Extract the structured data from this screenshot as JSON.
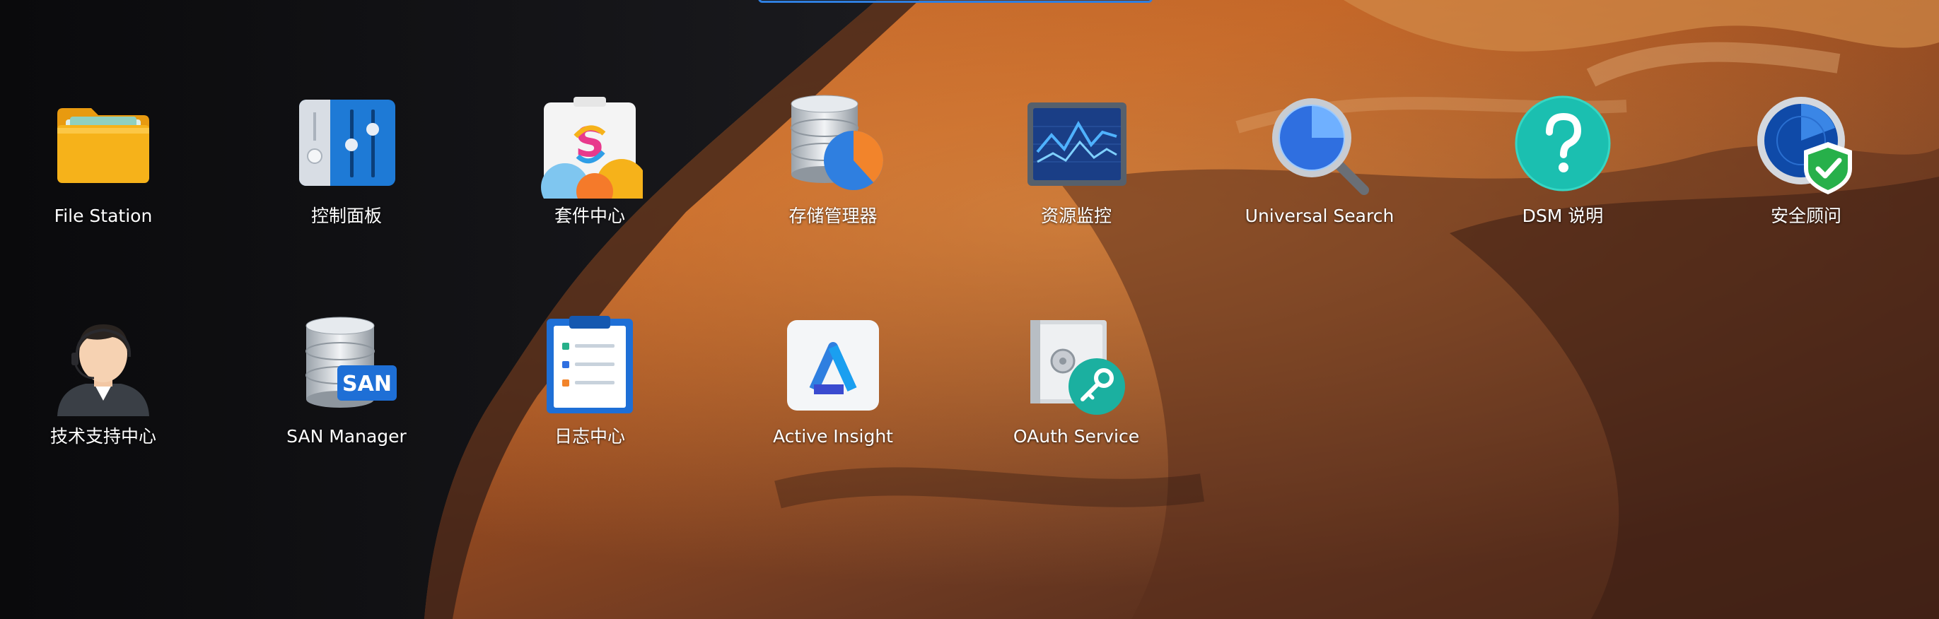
{
  "desktop": {
    "apps": [
      {
        "label": "File Station",
        "icon": "folder-icon"
      },
      {
        "label": "控制面板",
        "icon": "sliders-icon"
      },
      {
        "label": "套件中心",
        "icon": "package-center-icon"
      },
      {
        "label": "存储管理器",
        "icon": "storage-pie-icon"
      },
      {
        "label": "资源监控",
        "icon": "monitor-graph-icon"
      },
      {
        "label": "Universal Search",
        "icon": "magnifier-icon"
      },
      {
        "label": "DSM 说明",
        "icon": "question-icon"
      },
      {
        "label": "安全顾问",
        "icon": "shield-check-icon"
      },
      {
        "label": "技术支持中心",
        "icon": "support-agent-icon"
      },
      {
        "label": "SAN Manager",
        "icon": "san-database-icon"
      },
      {
        "label": "日志中心",
        "icon": "clipboard-log-icon"
      },
      {
        "label": "Active Insight",
        "icon": "active-insight-icon"
      },
      {
        "label": "OAuth Service",
        "icon": "safe-key-icon"
      }
    ],
    "san_badge": "SAN"
  },
  "colors": {
    "accent": "#2f7fe0",
    "folder": "#f6b21a",
    "teal": "#1bbfb0",
    "pie_orange": "#f2842b",
    "pie_blue": "#2f7fe0"
  }
}
